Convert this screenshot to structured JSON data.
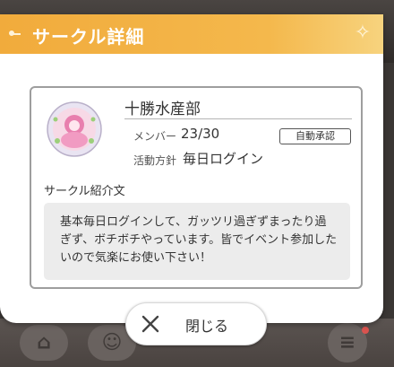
{
  "dialog": {
    "title": "サークル詳細",
    "sparkle_icon": "sparkle-icon"
  },
  "circle": {
    "name": "十勝水産部",
    "member_label": "メンバー",
    "member_count": "23/30",
    "approval_badge": "自動承認",
    "policy_label": "活動方針",
    "policy_value": "毎日ログイン",
    "intro_label": "サークル紹介文",
    "intro_text": "基本毎日ログインして、ガッツリ過ぎずまったり過ぎず、ボチボチやっています。皆でイベント参加したいので気楽にお使い下さい！"
  },
  "close_button": {
    "label": "閉じる",
    "icon": "close-icon"
  },
  "colors": {
    "title_bar": "#f1ab3c",
    "card_border": "#9e9e9e",
    "intro_bg": "#ececec"
  }
}
